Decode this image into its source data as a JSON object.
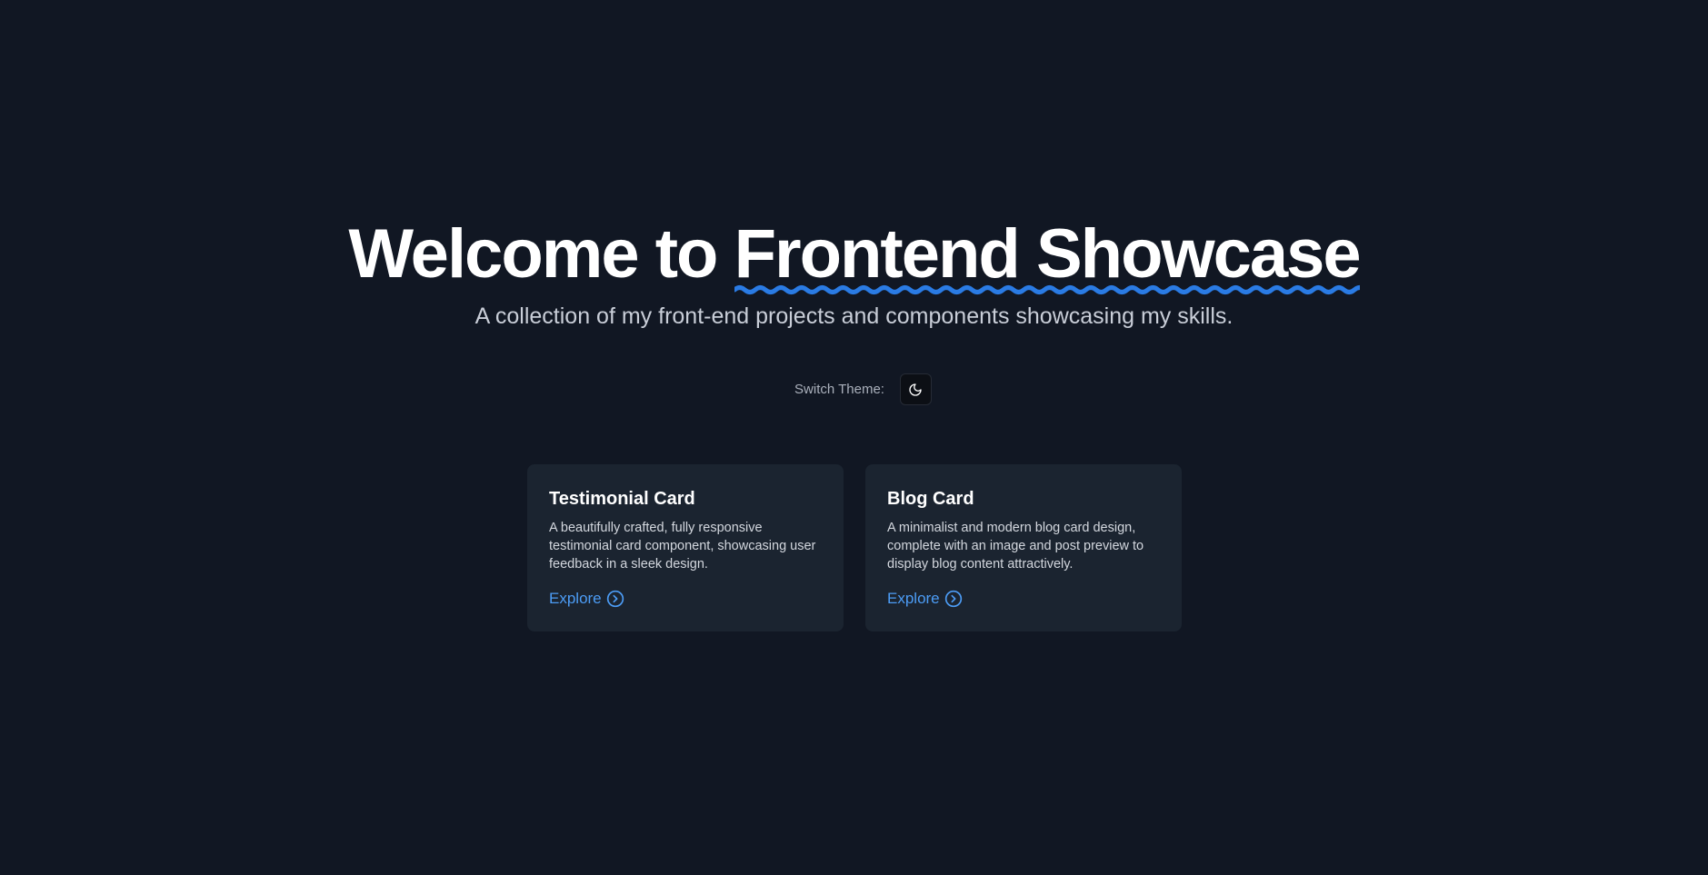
{
  "hero": {
    "title_prefix": "Welcome to ",
    "title_highlight": "Frontend Showcase",
    "subtitle": "A collection of my front-end projects and components showcasing my skills."
  },
  "theme": {
    "label": "Switch Theme:",
    "icon": "moon-icon"
  },
  "cards": [
    {
      "title": "Testimonial Card",
      "description": "A beautifully crafted, fully responsive testimonial card component, showcasing user feedback in a sleek design.",
      "link_label": "Explore",
      "link_icon": "chevron-right-circle-icon"
    },
    {
      "title": "Blog Card",
      "description": "A minimalist and modern blog card design, complete with an image and post preview to display blog content attractively.",
      "link_label": "Explore",
      "link_icon": "chevron-right-circle-icon"
    }
  ],
  "colors": {
    "background": "#111723",
    "card_background": "#1b2430",
    "accent": "#2a7be4",
    "link": "#4c9cf5"
  }
}
